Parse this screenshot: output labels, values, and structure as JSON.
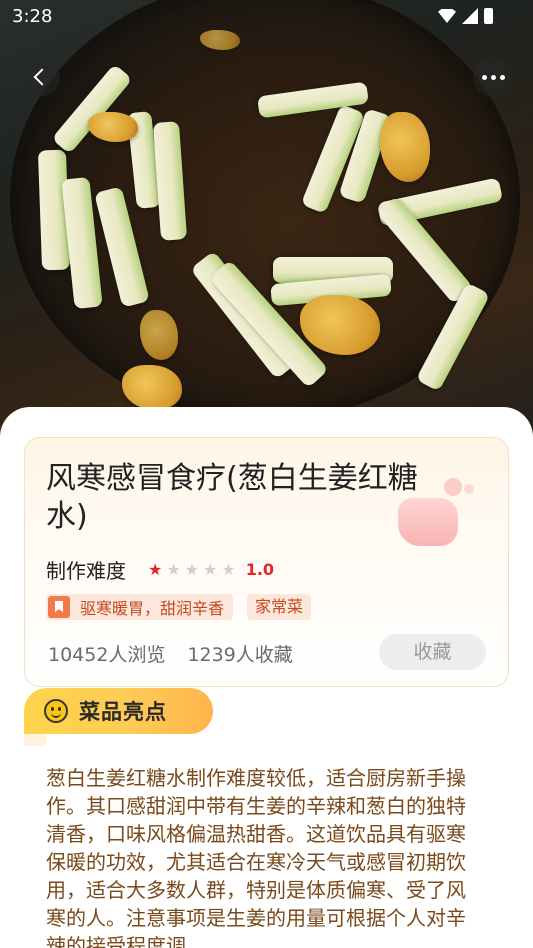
{
  "status_bar": {
    "time": "3:28"
  },
  "header": {
    "back_icon": "chevron-left-icon",
    "more_icon": "more-dots-icon"
  },
  "recipe": {
    "title": "风寒感冒食疗(葱白生姜红糖水)",
    "difficulty_label": "制作难度",
    "rating": "1.0",
    "stars_filled": 1,
    "stars_total": 5,
    "tags": [
      "驱寒暖胃，甜润辛香",
      "家常菜"
    ],
    "views": "10452人浏览",
    "favorites": "1239人收藏",
    "collect_button": "收藏"
  },
  "highlights": {
    "badge_label": "菜品亮点",
    "text": "葱白生姜红糖水制作难度较低，适合厨房新手操作。其口感甜润中带有生姜的辛辣和葱白的独特清香，口味风格偏温热甜香。这道饮品具有驱寒保暖的功效，尤其适合在寒冷天气或感冒初期饮用，适合大多数人群，特别是体质偏寒、受了风寒的人。注意事项是生姜的用量可根据个人对辛辣的接受程度调"
  },
  "colors": {
    "accent_red": "#e5252a",
    "tag_bg": "#fde7dc",
    "tag_text": "#c14a1f",
    "highlight_text": "#7a4a1c",
    "badge_yellow": "#ffd44a"
  }
}
